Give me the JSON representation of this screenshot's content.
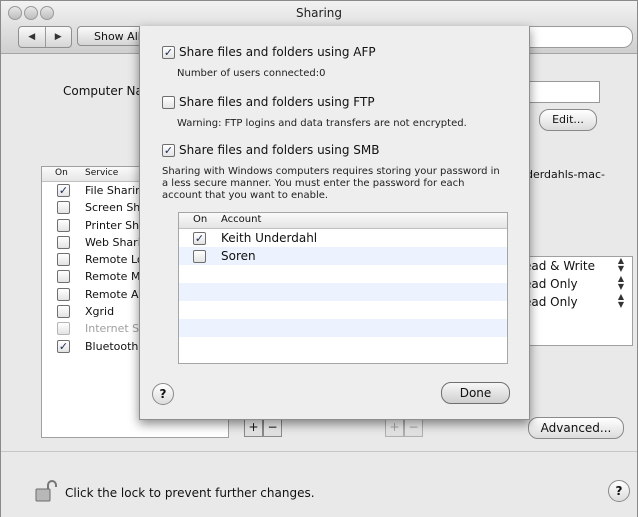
{
  "window": {
    "title": "Sharing",
    "show_all_label": "Show All",
    "computer_name_label": "Computer Name:",
    "edit_label": "Edit...",
    "host_suffix": "nderdahls-mac-",
    "advanced_label": "Advanced...",
    "lock_text": "Click the lock to prevent further changes.",
    "help_label": "?"
  },
  "services": {
    "col_on": "On",
    "col_service": "Service",
    "items": [
      {
        "label": "File Sharing",
        "checked": true
      },
      {
        "label": "Screen Sharing",
        "checked": false
      },
      {
        "label": "Printer Sharing",
        "checked": false
      },
      {
        "label": "Web Sharing",
        "checked": false
      },
      {
        "label": "Remote Login",
        "checked": false
      },
      {
        "label": "Remote Management",
        "checked": false
      },
      {
        "label": "Remote Apple Events",
        "checked": false
      },
      {
        "label": "Xgrid",
        "checked": false
      },
      {
        "label": "Internet Sharing",
        "checked": false,
        "disabled": true
      },
      {
        "label": "Bluetooth Sharing",
        "checked": true
      }
    ],
    "plus": "+",
    "minus": "−"
  },
  "permissions": {
    "items": [
      "ead & Write",
      "ead Only",
      "ead Only"
    ]
  },
  "sheet": {
    "afp_label": "Share files and folders using AFP",
    "afp_sub": "Number of users connected:0",
    "ftp_label": "Share files and folders using FTP",
    "ftp_sub": "Warning: FTP logins and data transfers are not encrypted.",
    "smb_label": "Share files and folders using SMB",
    "smb_sub": "Sharing with Windows computers requires storing your password in a less secure manner.  You must enter the password for each account that you want to enable.",
    "account_col_on": "On",
    "account_col_name": "Account",
    "accounts": [
      {
        "name": "Keith Underdahl",
        "checked": true
      },
      {
        "name": "Soren",
        "checked": false
      }
    ],
    "help_label": "?",
    "done_label": "Done"
  }
}
